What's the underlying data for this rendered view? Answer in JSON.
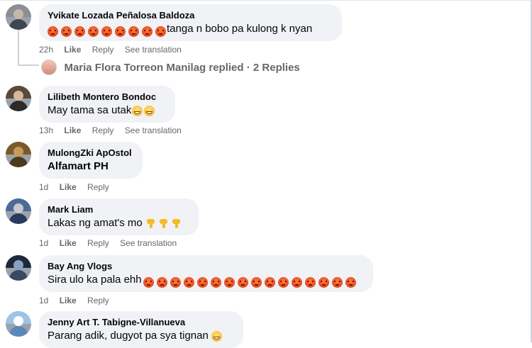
{
  "comments": [
    {
      "author": "Yvikate Lozada Peñalosa Baldoza",
      "text": "tanga n bobo pa kulong k nyan",
      "emoji": "angry-face",
      "emoji_count_before": 9,
      "time": "22h",
      "like": "Like",
      "reply": "Reply",
      "translate": "See translation",
      "avatar_colors": [
        "#8a8f96",
        "#c9b7a6",
        "#3e4650"
      ]
    },
    {
      "author": "Lilibeth Montero Bondoc",
      "text": "May tama sa utak",
      "emoji": "grinning-face",
      "emoji_count_after": 2,
      "time": "13h",
      "like": "Like",
      "reply": "Reply",
      "translate": "See translation",
      "avatar_colors": [
        "#5a4a3a",
        "#d8b79a",
        "#2d2a28"
      ]
    },
    {
      "author": "MulongZki ApOstol",
      "text": "Alfamart PH",
      "time": "1d",
      "like": "Like",
      "reply": "Reply",
      "avatar_colors": [
        "#7b5a2a",
        "#c79a5a",
        "#4d3a1e"
      ]
    },
    {
      "author": "Mark Liam",
      "text": "Lakas ng amat's mo",
      "emoji": "thumbs-down",
      "emoji_count_after": 3,
      "time": "1d",
      "like": "Like",
      "reply": "Reply",
      "translate": "See translation",
      "avatar_colors": [
        "#4a6a9a",
        "#c8c8d0",
        "#2a3a5a"
      ]
    },
    {
      "author": "Bay Ang Vlogs",
      "text": "Sira ulo ka pala ehh",
      "emoji": "angry-face",
      "emoji_count_after": 16,
      "time": "1d",
      "like": "Like",
      "reply": "Reply",
      "avatar_colors": [
        "#1e2a3a",
        "#8aa0c0",
        "#3a4a60"
      ]
    },
    {
      "author": "Jenny Art T. Tabigne-Villanueva",
      "text": "Parang adik, dugyot pa sya tignan",
      "emoji": "grinning-face",
      "emoji_count_after": 1,
      "avatar_colors": [
        "#9ec3e6",
        "#ffffff",
        "#5a88b8"
      ]
    }
  ],
  "replies_summary": {
    "author": "Maria Flora Torreon Manilag",
    "text": "Maria Flora Torreon Manilag replied · 2 Replies"
  }
}
